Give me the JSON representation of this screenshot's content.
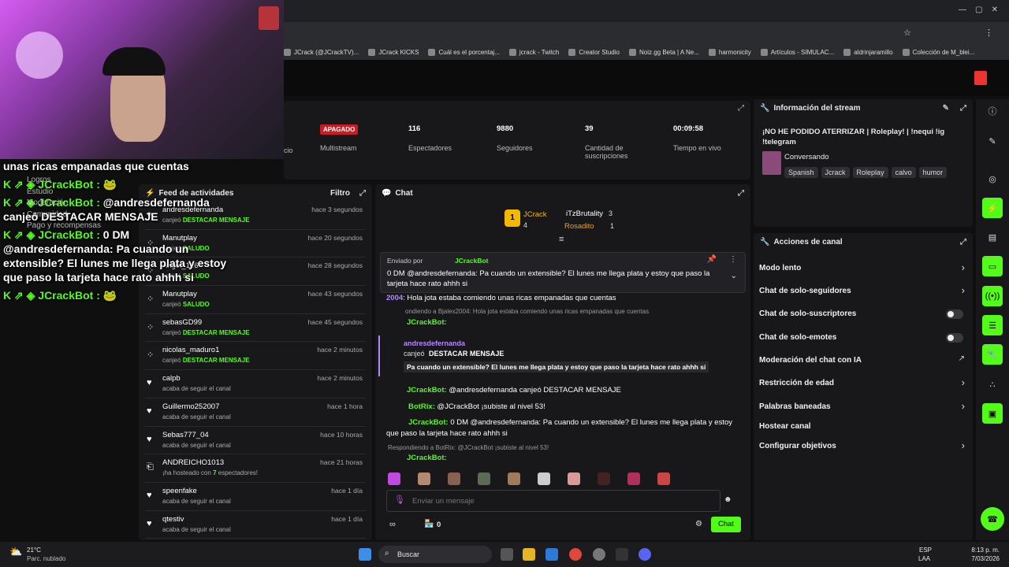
{
  "browser": {
    "bookmarks": [
      "JCrack (@JCrackTV)...",
      "JCrack KICKS",
      "Cuál es el porcentaj...",
      "jcrack - Twitch",
      "Creator Studio",
      "Noiz.gg Beta | A Ne...",
      "harmonicity",
      "Artículos - SIMULAC...",
      "aldrinjaramillo",
      "Colección de M_blei..."
    ]
  },
  "overlay": {
    "top": "unas ricas empanadas que cuentas",
    "lines": [
      {
        "user": "JCrackBot :",
        "text": ""
      },
      {
        "user": "JCrackBot :",
        "text": "@andresdefernanda canjeó DESTACAR MENSAJE"
      },
      {
        "user": "JCrackBot :",
        "text": "0 DM @andresdefernanda: Pa cuando un extensible? El lunes me llega plata y estoy que paso la tarjeta hace rato ahhh si"
      },
      {
        "user": "JCrackBot :",
        "text": ""
      }
    ],
    "sidemenu": [
      "Logros",
      "Estudio",
      "Moderación",
      "Comunidad",
      "Pago y recompensas"
    ]
  },
  "stats": {
    "partial": "cio",
    "multistream_badge": "APAGADO",
    "multistream": "Multistream",
    "viewers": "116",
    "viewers_label": "Espectadores",
    "followers": "9880",
    "followers_label": "Seguidores",
    "subs": "39",
    "subs_label": "Cantidad de suscripciones",
    "uptime": "00:09:58",
    "uptime_label": "Tiempo en vivo"
  },
  "feed": {
    "title": "Feed de actividades",
    "filter": "Filtro",
    "items": [
      {
        "icon": "user",
        "name": "andresdefernanda",
        "action": "canjeó",
        "highlight": "DESTACAR MENSAJE",
        "time": "hace 3 segundos"
      },
      {
        "icon": "bubbles",
        "name": "Manutplay",
        "action": "canjeó",
        "highlight": "SALUDO",
        "time": "hace 20 segundos"
      },
      {
        "icon": "bubbles",
        "name": "Angel_126",
        "action": "canjeó",
        "highlight": "SALUDO",
        "time": "hace 28 segundos"
      },
      {
        "icon": "bubbles",
        "name": "Manutplay",
        "action": "canjeó",
        "highlight": "SALUDO",
        "time": "hace 43 segundos"
      },
      {
        "icon": "bubbles",
        "name": "sebasGD99",
        "action": "canjeó",
        "highlight": "DESTACAR MENSAJE",
        "time": "hace 45 segundos"
      },
      {
        "icon": "bubbles",
        "name": "nicolas_maduro1",
        "action": "canjeó",
        "highlight": "DESTACAR MENSAJE",
        "time": "hace 2 minutos"
      },
      {
        "icon": "heart",
        "name": "calpb",
        "action": "acaba de seguir el canal",
        "highlight": "",
        "time": "hace 2 minutos"
      },
      {
        "icon": "heart",
        "name": "Guillermo252007",
        "action": "acaba de seguir el canal",
        "highlight": "",
        "time": "hace 1 hora"
      },
      {
        "icon": "heart",
        "name": "Sebas777_04",
        "action": "acaba de seguir el canal",
        "highlight": "",
        "time": "hace 10 horas"
      },
      {
        "icon": "host",
        "name": "ANDREICHO1013",
        "action": "¡ha hosteado con",
        "highlight": "7",
        "after": "espectadores!",
        "time": "hace 21 horas"
      },
      {
        "icon": "heart",
        "name": "speenfake",
        "action": "acaba de seguir el canal",
        "highlight": "",
        "time": "hace 1 día"
      },
      {
        "icon": "heart",
        "name": "qtestiv",
        "action": "acaba de seguir el canal",
        "highlight": "",
        "time": "hace 1 día"
      }
    ]
  },
  "chat": {
    "title": "Chat",
    "top": [
      {
        "rank": "1",
        "name": "JCrack",
        "count": "4"
      },
      {
        "name": "iTzBrutality",
        "count": "3"
      },
      {
        "name": "Rosadito",
        "count": "1"
      }
    ],
    "pinned": {
      "by": "Enviado por",
      "user": "JCrackBot",
      "text": "0 DM @andresdefernanda: Pa cuando un extensible? El lunes me llega plata y estoy que paso la tarjeta hace rato ahhh si"
    },
    "m1": {
      "user": "2004",
      "text": ": Hola jota estaba comiendo unas ricas empanadas que cuentas"
    },
    "reply1": "ondiendo a Bjalex2004: Hola jota estaba comiendo unas ricas empanadas que cuentas",
    "bot": "JCrackBot:",
    "redeem": {
      "user": "andresdefernanda",
      "line": "canjeó",
      "bold": "DESTACAR MENSAJE",
      "msg": "Pa cuando un extensible? El lunes me llega plata y estoy que paso la tarjeta hace rato ahhh si"
    },
    "m2": "@andresdefernanda canjeó DESTACAR MENSAJE",
    "botrix": "BotRix:",
    "m3": "@JCrackBot ¡subiste al nivel 53!",
    "m4": "0 DM @andresdefernanda: Pa cuando un extensible? El lunes me llega plata y estoy que paso la tarjeta hace rato ahhh si",
    "reply2": "Respondiendo a BotRix: @JCrackBot ¡subiste al nivel 53!",
    "placeholder": "Enviar un mensaje",
    "points": "0",
    "send": "Chat"
  },
  "info": {
    "title": "Información del stream",
    "stream_title": "¡NO HE PODIDO ATERRIZAR | Roleplay! | !nequi !ig !telegram",
    "category": "Conversando",
    "tags": [
      "Spanish",
      "Jcrack",
      "Roleplay",
      "calvo",
      "humor"
    ]
  },
  "actions": {
    "title": "Acciones de canal",
    "items": [
      "Modo lento",
      "Chat de solo-seguidores",
      "Chat de solo-suscriptores",
      "Chat de solo-emotes",
      "Moderación del chat con IA",
      "Restricción de edad",
      "Palabras baneadas",
      "Hostear canal",
      "Configurar objetivos"
    ]
  },
  "taskbar": {
    "temp": "21°C",
    "weather": "Parc. nublado",
    "search": "Buscar",
    "lang1": "ESP",
    "lang2": "LAA",
    "time": "8:13 p. m.",
    "date": "7/03/2026"
  },
  "colors": {
    "accent": "#53fc18",
    "panel": "#18181b"
  }
}
